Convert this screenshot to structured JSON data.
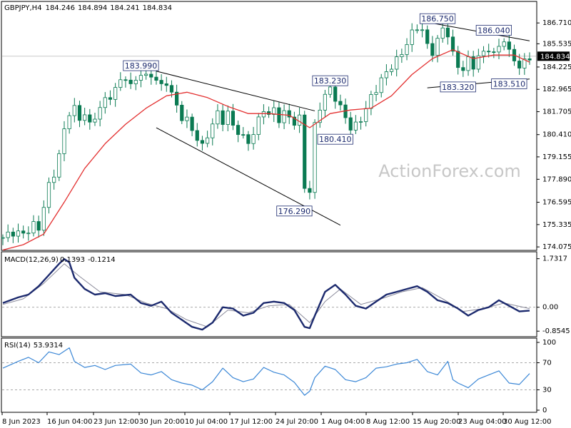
{
  "chart_data": [
    {
      "type": "candlestick",
      "panel": "price",
      "title": "GBPJPY,H4",
      "ohlc": [
        "184.246",
        "184.894",
        "184.241",
        "184.834"
      ],
      "last_price": "184.834",
      "y_ticks": [
        "186.710",
        "185.535",
        "184.225",
        "182.965",
        "181.705",
        "180.410",
        "179.155",
        "177.890",
        "176.595",
        "175.335",
        "174.075"
      ],
      "ylim": [
        174.0,
        187.2
      ],
      "x_ticks": [
        "8 Jun 2023",
        "16 Jun 04:00",
        "23 Jun 12:00",
        "30 Jun 20:00",
        "10 Jul 04:00",
        "17 Jul 12:00",
        "24 Jul 20:00",
        "1 Aug 04:00",
        "8 Aug 12:00",
        "15 Aug 20:00",
        "23 Aug 04:00",
        "30 Aug 12:00"
      ],
      "annotations": [
        "183.990",
        "183.230",
        "180.410",
        "176.290",
        "186.750",
        "186.040",
        "183.320",
        "183.510"
      ],
      "watermark": "ActionForex.com",
      "close_path": [
        [
          0,
          174.6
        ],
        [
          2,
          174.9
        ],
        [
          4,
          174.8
        ],
        [
          6,
          175.3
        ],
        [
          7,
          175.1
        ],
        [
          8,
          176.4
        ],
        [
          9,
          177.5
        ],
        [
          10,
          178.2
        ],
        [
          11,
          179.3
        ],
        [
          12,
          180.6
        ],
        [
          13,
          181.7
        ],
        [
          14,
          181.9
        ],
        [
          15,
          181.2
        ],
        [
          16,
          181.7
        ],
        [
          17,
          180.9
        ],
        [
          18,
          181.4
        ],
        [
          19,
          182.0
        ],
        [
          20,
          182.3
        ],
        [
          21,
          182.6
        ],
        [
          22,
          183.0
        ],
        [
          23,
          183.4
        ],
        [
          24,
          183.7
        ],
        [
          25,
          183.1
        ],
        [
          26,
          183.5
        ],
        [
          27,
          183.9
        ],
        [
          28,
          183.6
        ],
        [
          29,
          183.8
        ],
        [
          30,
          183.5
        ],
        [
          31,
          183.1
        ],
        [
          32,
          183.4
        ],
        [
          33,
          182.7
        ],
        [
          34,
          182.0
        ],
        [
          35,
          181.4
        ],
        [
          36,
          181.2
        ],
        [
          37,
          180.7
        ],
        [
          38,
          180.2
        ],
        [
          39,
          179.7
        ],
        [
          40,
          180.4
        ],
        [
          41,
          181.0
        ],
        [
          42,
          181.6
        ],
        [
          43,
          181.2
        ],
        [
          44,
          181.6
        ],
        [
          45,
          180.9
        ],
        [
          46,
          180.6
        ],
        [
          47,
          180.2
        ],
        [
          48,
          180.0
        ],
        [
          49,
          180.5
        ],
        [
          50,
          181.2
        ],
        [
          51,
          181.9
        ],
        [
          52,
          181.5
        ],
        [
          53,
          181.8
        ],
        [
          54,
          181.3
        ],
        [
          55,
          181.6
        ],
        [
          56,
          181.4
        ],
        [
          57,
          181.1
        ],
        [
          58,
          181.3
        ],
        [
          59,
          177.5
        ],
        [
          60,
          177.2
        ],
        [
          61,
          180.9
        ],
        [
          62,
          182.0
        ],
        [
          63,
          182.6
        ],
        [
          64,
          183.0
        ],
        [
          65,
          182.5
        ],
        [
          66,
          181.9
        ],
        [
          67,
          181.4
        ],
        [
          68,
          180.8
        ],
        [
          69,
          180.9
        ],
        [
          70,
          181.3
        ],
        [
          71,
          181.9
        ],
        [
          72,
          182.5
        ],
        [
          73,
          183.0
        ],
        [
          74,
          183.5
        ],
        [
          75,
          183.9
        ],
        [
          76,
          184.3
        ],
        [
          77,
          184.6
        ],
        [
          78,
          185.0
        ],
        [
          79,
          185.6
        ],
        [
          80,
          186.1
        ],
        [
          81,
          186.5
        ],
        [
          82,
          186.3
        ],
        [
          83,
          185.4
        ],
        [
          84,
          185.1
        ],
        [
          85,
          185.7
        ],
        [
          86,
          186.4
        ],
        [
          87,
          186.1
        ],
        [
          88,
          184.9
        ],
        [
          89,
          184.3
        ],
        [
          90,
          184.1
        ],
        [
          91,
          184.6
        ],
        [
          92,
          184.3
        ],
        [
          93,
          184.8
        ],
        [
          94,
          185.0
        ],
        [
          95,
          185.3
        ],
        [
          96,
          184.9
        ],
        [
          97,
          185.4
        ],
        [
          98,
          185.8
        ],
        [
          99,
          185.0
        ],
        [
          100,
          184.7
        ],
        [
          101,
          184.2
        ],
        [
          102,
          184.5
        ],
        [
          103,
          184.83
        ]
      ]
    },
    {
      "type": "line",
      "panel": "macd",
      "title": "MACD(12,26,9)",
      "values_text": [
        "0.1393",
        "-0.1214"
      ],
      "y_ticks": [
        "1.7317",
        "0.00",
        "-0.8545"
      ],
      "ylim": [
        -0.95,
        1.85
      ],
      "macd_path": [
        [
          0,
          0.15
        ],
        [
          3,
          0.35
        ],
        [
          5,
          0.45
        ],
        [
          7,
          0.75
        ],
        [
          9,
          1.15
        ],
        [
          11,
          1.55
        ],
        [
          12,
          1.72
        ],
        [
          13,
          1.6
        ],
        [
          14,
          1.05
        ],
        [
          16,
          0.65
        ],
        [
          18,
          0.45
        ],
        [
          20,
          0.5
        ],
        [
          22,
          0.4
        ],
        [
          25,
          0.45
        ],
        [
          27,
          0.15
        ],
        [
          29,
          0.05
        ],
        [
          31,
          0.2
        ],
        [
          33,
          -0.2
        ],
        [
          35,
          -0.45
        ],
        [
          37,
          -0.7
        ],
        [
          39,
          -0.8
        ],
        [
          41,
          -0.55
        ],
        [
          43,
          0.0
        ],
        [
          45,
          -0.05
        ],
        [
          47,
          -0.3
        ],
        [
          49,
          -0.2
        ],
        [
          51,
          0.15
        ],
        [
          53,
          0.2
        ],
        [
          55,
          0.15
        ],
        [
          57,
          -0.1
        ],
        [
          59,
          -0.7
        ],
        [
          60,
          -0.75
        ],
        [
          61,
          -0.3
        ],
        [
          63,
          0.55
        ],
        [
          65,
          0.8
        ],
        [
          67,
          0.45
        ],
        [
          69,
          0.05
        ],
        [
          71,
          -0.05
        ],
        [
          73,
          0.2
        ],
        [
          75,
          0.45
        ],
        [
          77,
          0.55
        ],
        [
          79,
          0.65
        ],
        [
          81,
          0.75
        ],
        [
          83,
          0.55
        ],
        [
          85,
          0.25
        ],
        [
          87,
          0.15
        ],
        [
          89,
          -0.05
        ],
        [
          91,
          -0.3
        ],
        [
          93,
          -0.1
        ],
        [
          95,
          0.0
        ],
        [
          97,
          0.25
        ],
        [
          99,
          0.05
        ],
        [
          101,
          -0.15
        ],
        [
          103,
          -0.12
        ]
      ],
      "signal_path": [
        [
          0,
          0.1
        ],
        [
          4,
          0.3
        ],
        [
          8,
          0.85
        ],
        [
          12,
          1.55
        ],
        [
          15,
          1.1
        ],
        [
          19,
          0.55
        ],
        [
          24,
          0.45
        ],
        [
          28,
          0.15
        ],
        [
          32,
          -0.05
        ],
        [
          36,
          -0.45
        ],
        [
          40,
          -0.7
        ],
        [
          44,
          -0.1
        ],
        [
          48,
          -0.2
        ],
        [
          52,
          0.05
        ],
        [
          56,
          0.1
        ],
        [
          60,
          -0.55
        ],
        [
          63,
          0.2
        ],
        [
          66,
          0.65
        ],
        [
          70,
          0.1
        ],
        [
          74,
          0.3
        ],
        [
          78,
          0.55
        ],
        [
          82,
          0.7
        ],
        [
          86,
          0.3
        ],
        [
          90,
          -0.15
        ],
        [
          94,
          -0.05
        ],
        [
          98,
          0.15
        ],
        [
          103,
          -0.05
        ]
      ]
    },
    {
      "type": "line",
      "panel": "rsi",
      "title": "RSI(14)",
      "value_text": "53.9314",
      "y_ticks": [
        "100",
        "70",
        "30",
        "0"
      ],
      "ylim": [
        0,
        100
      ],
      "levels": [
        70,
        30
      ],
      "rsi_path": [
        [
          0,
          62
        ],
        [
          3,
          72
        ],
        [
          5,
          78
        ],
        [
          7,
          70
        ],
        [
          9,
          86
        ],
        [
          11,
          82
        ],
        [
          13,
          92
        ],
        [
          14,
          72
        ],
        [
          16,
          63
        ],
        [
          18,
          66
        ],
        [
          20,
          60
        ],
        [
          22,
          66
        ],
        [
          25,
          68
        ],
        [
          27,
          55
        ],
        [
          29,
          52
        ],
        [
          31,
          57
        ],
        [
          33,
          45
        ],
        [
          35,
          40
        ],
        [
          37,
          37
        ],
        [
          39,
          30
        ],
        [
          41,
          42
        ],
        [
          43,
          62
        ],
        [
          45,
          48
        ],
        [
          47,
          42
        ],
        [
          49,
          46
        ],
        [
          51,
          63
        ],
        [
          53,
          56
        ],
        [
          55,
          52
        ],
        [
          57,
          41
        ],
        [
          59,
          22
        ],
        [
          60,
          28
        ],
        [
          61,
          48
        ],
        [
          63,
          65
        ],
        [
          65,
          60
        ],
        [
          67,
          45
        ],
        [
          69,
          42
        ],
        [
          71,
          48
        ],
        [
          73,
          62
        ],
        [
          75,
          64
        ],
        [
          77,
          68
        ],
        [
          79,
          70
        ],
        [
          81,
          75
        ],
        [
          83,
          57
        ],
        [
          85,
          52
        ],
        [
          87,
          72
        ],
        [
          88,
          45
        ],
        [
          89,
          40
        ],
        [
          91,
          33
        ],
        [
          93,
          46
        ],
        [
          95,
          52
        ],
        [
          97,
          58
        ],
        [
          99,
          40
        ],
        [
          101,
          38
        ],
        [
          103,
          54
        ]
      ]
    }
  ],
  "colors": {
    "candle": "#0a7a52",
    "ma": "#e33030",
    "macd": "#1c2a6e",
    "signal": "#8a8a9a",
    "rsi": "#3b87d6",
    "trend": "#000000",
    "accent_text": "#1c2a6e",
    "price_tag_bg": "#000000"
  },
  "ma_path": [
    [
      0,
      173.9
    ],
    [
      4,
      174.2
    ],
    [
      8,
      174.8
    ],
    [
      12,
      176.6
    ],
    [
      16,
      178.5
    ],
    [
      20,
      179.9
    ],
    [
      24,
      181.0
    ],
    [
      28,
      181.9
    ],
    [
      32,
      182.6
    ],
    [
      36,
      182.8
    ],
    [
      40,
      182.5
    ],
    [
      44,
      182.0
    ],
    [
      48,
      181.6
    ],
    [
      52,
      181.6
    ],
    [
      56,
      181.5
    ],
    [
      60,
      180.8
    ],
    [
      64,
      181.6
    ],
    [
      68,
      181.8
    ],
    [
      72,
      181.9
    ],
    [
      76,
      182.6
    ],
    [
      80,
      183.8
    ],
    [
      84,
      184.7
    ],
    [
      88,
      185.2
    ],
    [
      92,
      184.7
    ],
    [
      96,
      184.9
    ],
    [
      100,
      184.9
    ],
    [
      103,
      184.5
    ]
  ]
}
